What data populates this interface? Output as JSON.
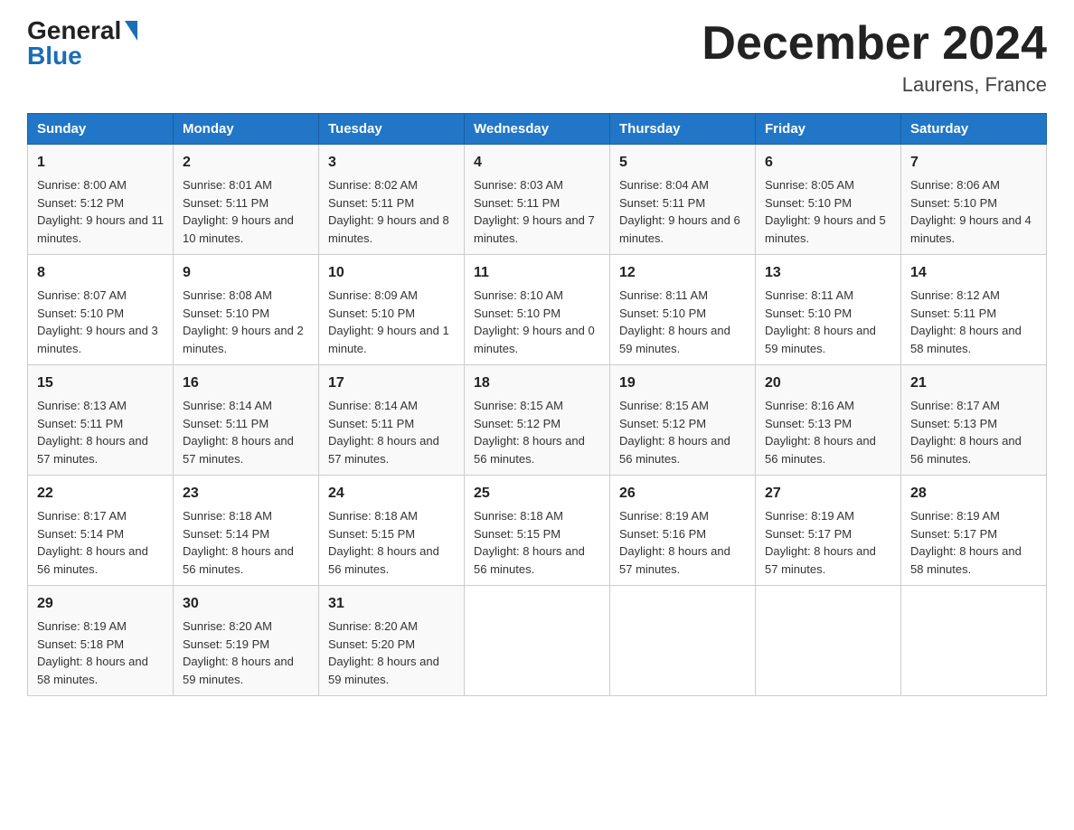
{
  "logo": {
    "general": "General",
    "blue": "Blue"
  },
  "title": "December 2024",
  "location": "Laurens, France",
  "weekdays": [
    "Sunday",
    "Monday",
    "Tuesday",
    "Wednesday",
    "Thursday",
    "Friday",
    "Saturday"
  ],
  "weeks": [
    [
      {
        "day": "1",
        "sunrise": "8:00 AM",
        "sunset": "5:12 PM",
        "daylight": "9 hours and 11 minutes."
      },
      {
        "day": "2",
        "sunrise": "8:01 AM",
        "sunset": "5:11 PM",
        "daylight": "9 hours and 10 minutes."
      },
      {
        "day": "3",
        "sunrise": "8:02 AM",
        "sunset": "5:11 PM",
        "daylight": "9 hours and 8 minutes."
      },
      {
        "day": "4",
        "sunrise": "8:03 AM",
        "sunset": "5:11 PM",
        "daylight": "9 hours and 7 minutes."
      },
      {
        "day": "5",
        "sunrise": "8:04 AM",
        "sunset": "5:11 PM",
        "daylight": "9 hours and 6 minutes."
      },
      {
        "day": "6",
        "sunrise": "8:05 AM",
        "sunset": "5:10 PM",
        "daylight": "9 hours and 5 minutes."
      },
      {
        "day": "7",
        "sunrise": "8:06 AM",
        "sunset": "5:10 PM",
        "daylight": "9 hours and 4 minutes."
      }
    ],
    [
      {
        "day": "8",
        "sunrise": "8:07 AM",
        "sunset": "5:10 PM",
        "daylight": "9 hours and 3 minutes."
      },
      {
        "day": "9",
        "sunrise": "8:08 AM",
        "sunset": "5:10 PM",
        "daylight": "9 hours and 2 minutes."
      },
      {
        "day": "10",
        "sunrise": "8:09 AM",
        "sunset": "5:10 PM",
        "daylight": "9 hours and 1 minute."
      },
      {
        "day": "11",
        "sunrise": "8:10 AM",
        "sunset": "5:10 PM",
        "daylight": "9 hours and 0 minutes."
      },
      {
        "day": "12",
        "sunrise": "8:11 AM",
        "sunset": "5:10 PM",
        "daylight": "8 hours and 59 minutes."
      },
      {
        "day": "13",
        "sunrise": "8:11 AM",
        "sunset": "5:10 PM",
        "daylight": "8 hours and 59 minutes."
      },
      {
        "day": "14",
        "sunrise": "8:12 AM",
        "sunset": "5:11 PM",
        "daylight": "8 hours and 58 minutes."
      }
    ],
    [
      {
        "day": "15",
        "sunrise": "8:13 AM",
        "sunset": "5:11 PM",
        "daylight": "8 hours and 57 minutes."
      },
      {
        "day": "16",
        "sunrise": "8:14 AM",
        "sunset": "5:11 PM",
        "daylight": "8 hours and 57 minutes."
      },
      {
        "day": "17",
        "sunrise": "8:14 AM",
        "sunset": "5:11 PM",
        "daylight": "8 hours and 57 minutes."
      },
      {
        "day": "18",
        "sunrise": "8:15 AM",
        "sunset": "5:12 PM",
        "daylight": "8 hours and 56 minutes."
      },
      {
        "day": "19",
        "sunrise": "8:15 AM",
        "sunset": "5:12 PM",
        "daylight": "8 hours and 56 minutes."
      },
      {
        "day": "20",
        "sunrise": "8:16 AM",
        "sunset": "5:13 PM",
        "daylight": "8 hours and 56 minutes."
      },
      {
        "day": "21",
        "sunrise": "8:17 AM",
        "sunset": "5:13 PM",
        "daylight": "8 hours and 56 minutes."
      }
    ],
    [
      {
        "day": "22",
        "sunrise": "8:17 AM",
        "sunset": "5:14 PM",
        "daylight": "8 hours and 56 minutes."
      },
      {
        "day": "23",
        "sunrise": "8:18 AM",
        "sunset": "5:14 PM",
        "daylight": "8 hours and 56 minutes."
      },
      {
        "day": "24",
        "sunrise": "8:18 AM",
        "sunset": "5:15 PM",
        "daylight": "8 hours and 56 minutes."
      },
      {
        "day": "25",
        "sunrise": "8:18 AM",
        "sunset": "5:15 PM",
        "daylight": "8 hours and 56 minutes."
      },
      {
        "day": "26",
        "sunrise": "8:19 AM",
        "sunset": "5:16 PM",
        "daylight": "8 hours and 57 minutes."
      },
      {
        "day": "27",
        "sunrise": "8:19 AM",
        "sunset": "5:17 PM",
        "daylight": "8 hours and 57 minutes."
      },
      {
        "day": "28",
        "sunrise": "8:19 AM",
        "sunset": "5:17 PM",
        "daylight": "8 hours and 58 minutes."
      }
    ],
    [
      {
        "day": "29",
        "sunrise": "8:19 AM",
        "sunset": "5:18 PM",
        "daylight": "8 hours and 58 minutes."
      },
      {
        "day": "30",
        "sunrise": "8:20 AM",
        "sunset": "5:19 PM",
        "daylight": "8 hours and 59 minutes."
      },
      {
        "day": "31",
        "sunrise": "8:20 AM",
        "sunset": "5:20 PM",
        "daylight": "8 hours and 59 minutes."
      },
      null,
      null,
      null,
      null
    ]
  ],
  "labels": {
    "sunrise": "Sunrise:",
    "sunset": "Sunset:",
    "daylight": "Daylight:"
  }
}
